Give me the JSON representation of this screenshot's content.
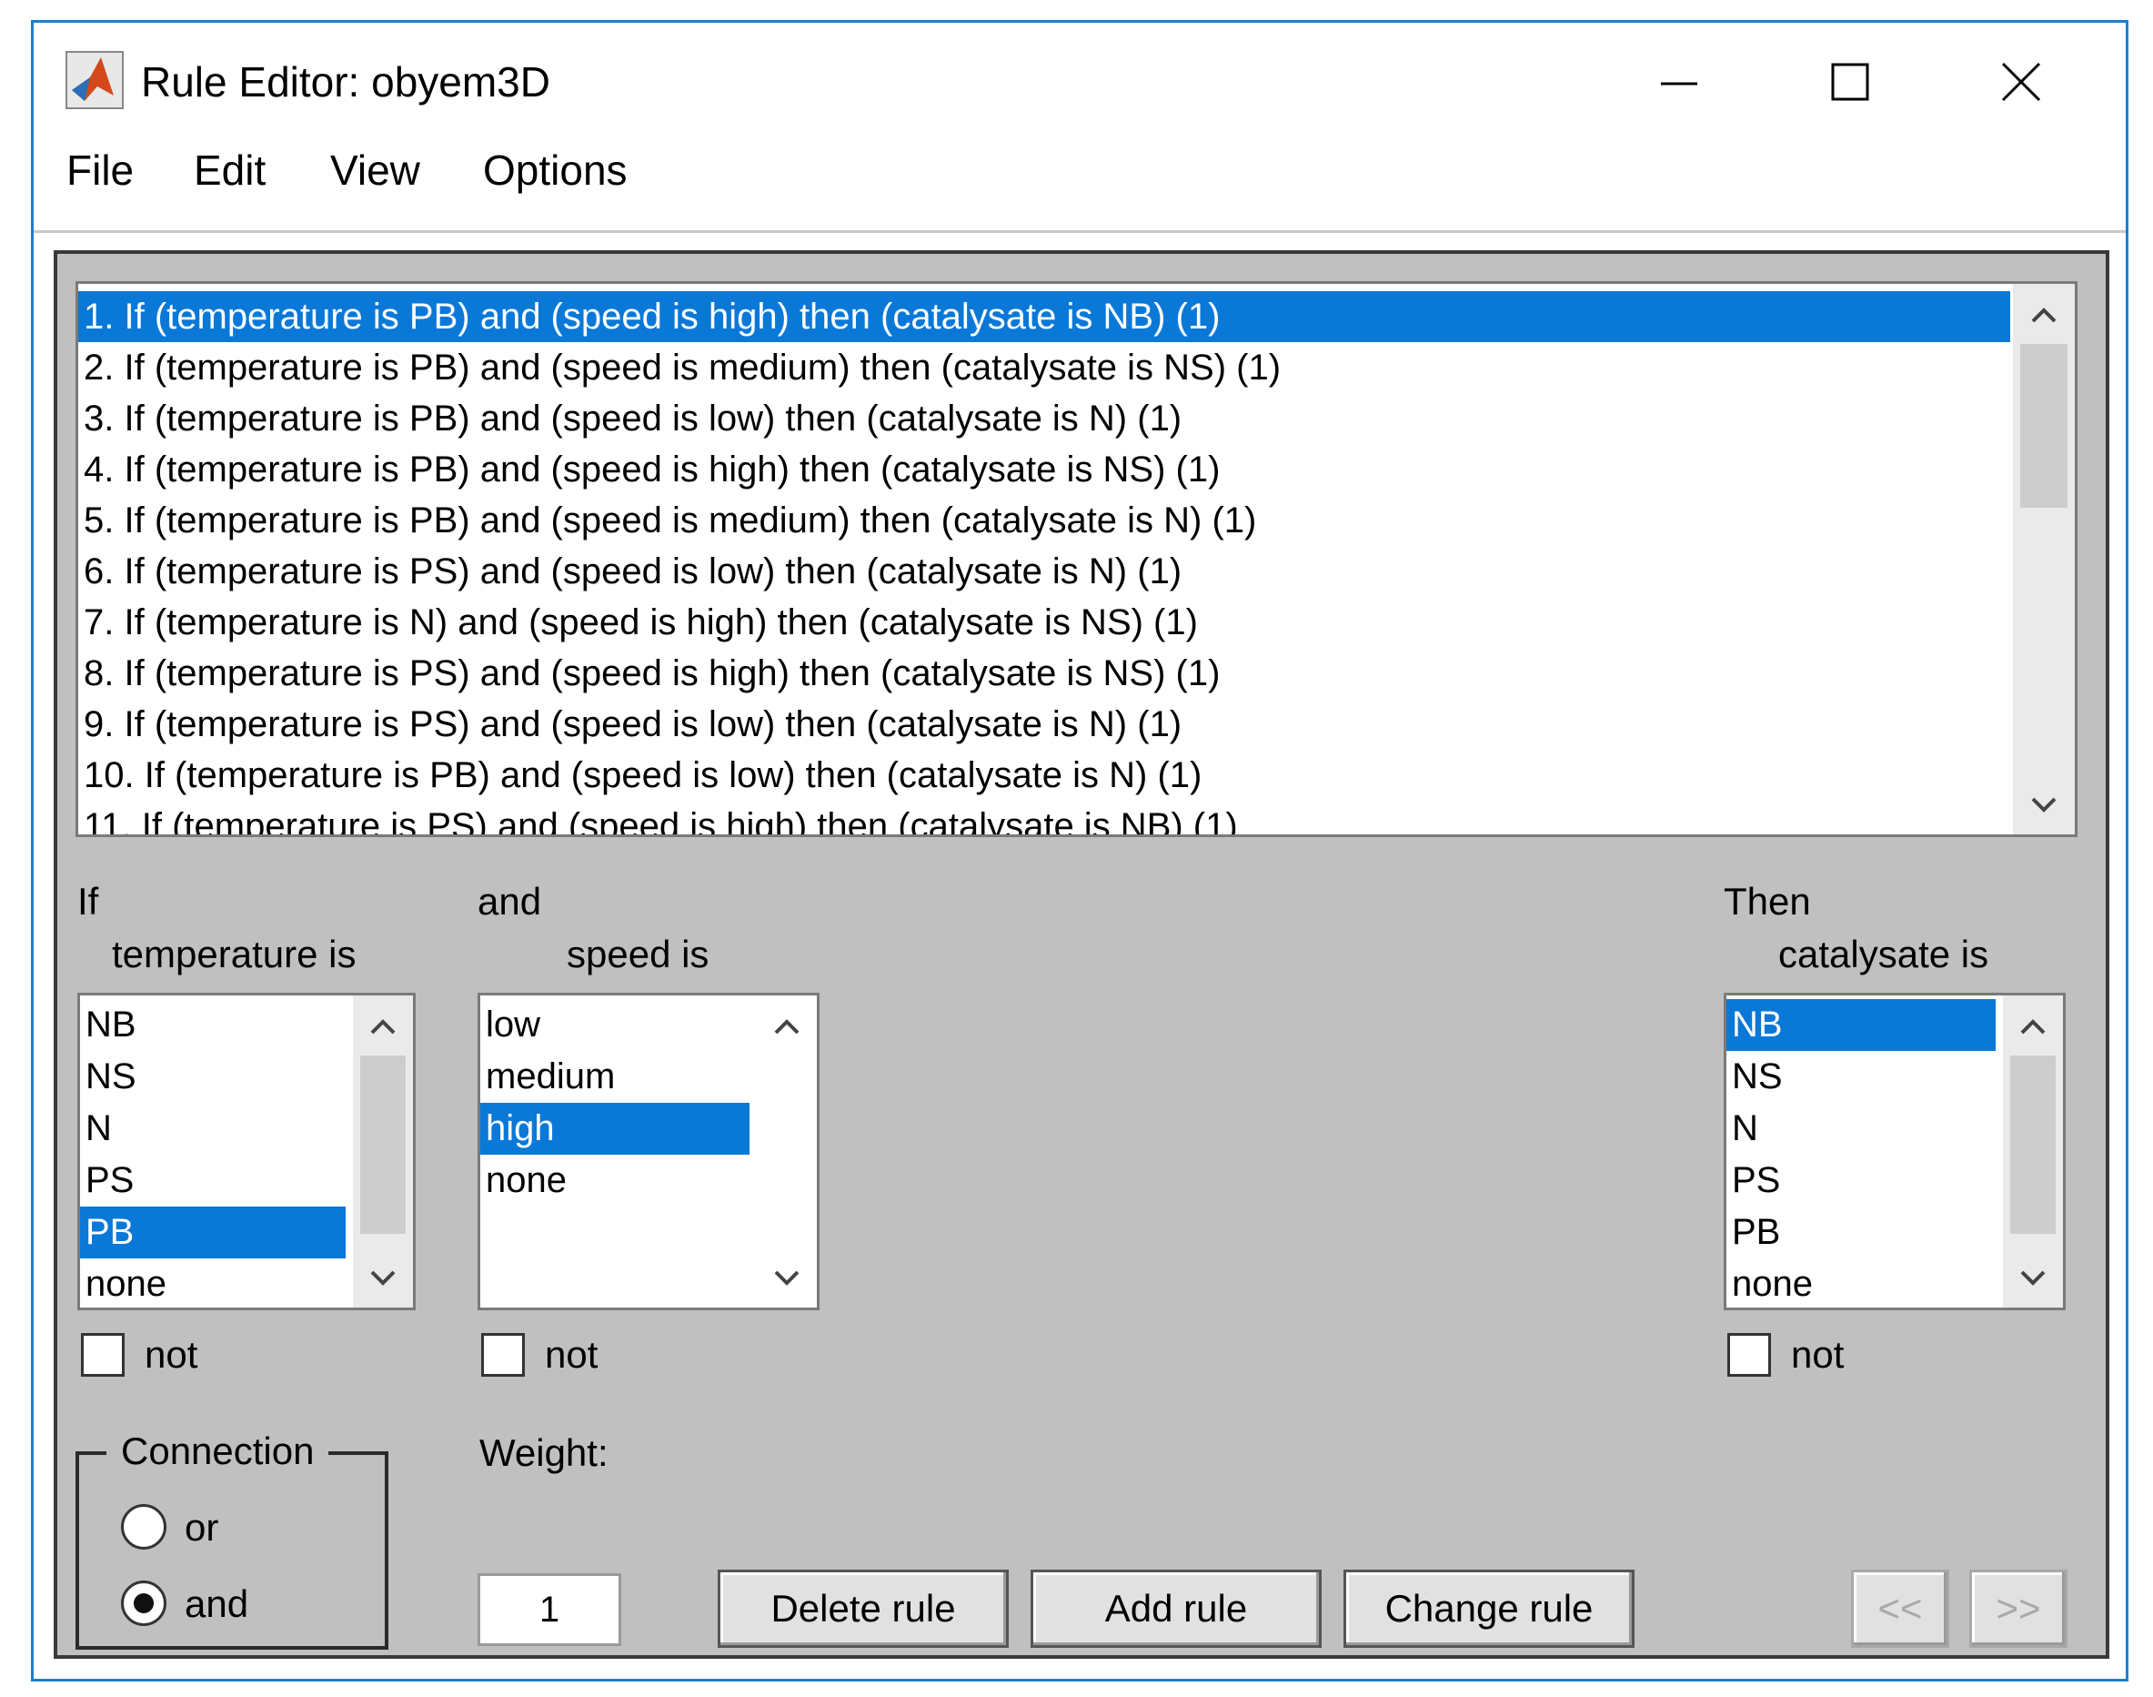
{
  "window": {
    "title": "Rule Editor: obyem3D",
    "menu": [
      "File",
      "Edit",
      "View",
      "Options"
    ]
  },
  "rules": [
    "1. If (temperature is PB) and (speed is high) then (catalysate is NB) (1)",
    "2. If (temperature is PB) and (speed is medium) then (catalysate is NS) (1)",
    "3. If (temperature is PB) and (speed is low) then (catalysate is N) (1)",
    "4. If (temperature is PB) and (speed is high) then (catalysate is NS) (1)",
    "5. If (temperature is PB) and (speed is medium) then (catalysate is N) (1)",
    "6. If (temperature is PS) and (speed is low) then (catalysate is N) (1)",
    "7. If (temperature is N) and (speed is high) then (catalysate is NS) (1)",
    "8. If (temperature is PS) and (speed is high) then (catalysate is NS) (1)",
    "9. If (temperature is PS) and (speed is low) then (catalysate is N) (1)",
    "10. If (temperature is PB) and (speed is low) then (catalysate is N) (1)",
    "11. If (temperature is PS) and (speed is high) then (catalysate is NB) (1)"
  ],
  "selected_rule_index": 0,
  "input1": {
    "prefix": "If",
    "label": "temperature is",
    "items": [
      "NB",
      "NS",
      "N",
      "PS",
      "PB",
      "none"
    ],
    "selected": 4,
    "not_label": "not"
  },
  "input2": {
    "prefix": "and",
    "label": "speed is",
    "items": [
      "low",
      "medium",
      "high",
      "none"
    ],
    "selected": 2,
    "not_label": "not"
  },
  "output": {
    "prefix": "Then",
    "label": "catalysate is",
    "items": [
      "NB",
      "NS",
      "N",
      "PS",
      "PB",
      "none"
    ],
    "selected": 0,
    "not_label": "not"
  },
  "connection": {
    "title": "Connection",
    "options": [
      "or",
      "and"
    ],
    "selected": "and"
  },
  "weight": {
    "label": "Weight:",
    "value": "1"
  },
  "buttons": {
    "delete": "Delete rule",
    "add": "Add rule",
    "change": "Change rule",
    "prev": "<<",
    "next": ">>"
  },
  "colors": {
    "selection": "#0a78d7",
    "panel": "#c0c0c0",
    "window_border": "#1a7fd4"
  }
}
